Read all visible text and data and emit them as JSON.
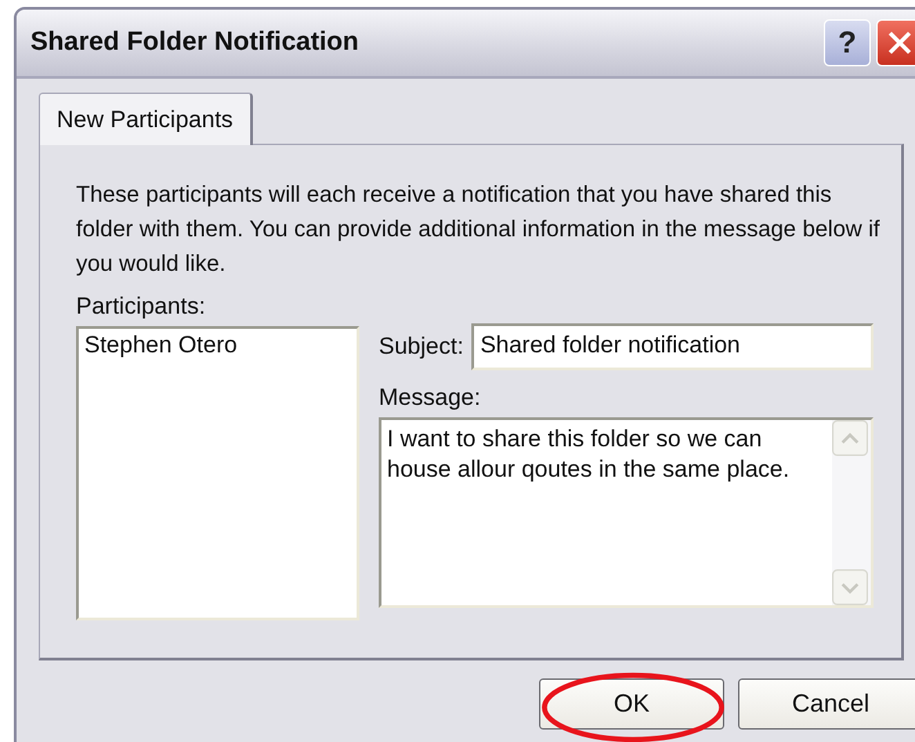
{
  "window": {
    "title": "Shared Folder Notification",
    "title_buttons": [
      {
        "kind": "help",
        "label": "?"
      },
      {
        "kind": "close"
      }
    ]
  },
  "tabs": [
    {
      "label": "New Participants",
      "selected": true
    }
  ],
  "description": "These participants will each receive a notification that you have shared this folder with them.  You can provide additional information in the message below if you would like.",
  "participants": {
    "label": "Participants:",
    "items": [
      "Stephen Otero"
    ]
  },
  "subject": {
    "label": "Subject:",
    "value": "Shared folder notification"
  },
  "message": {
    "label": "Message:",
    "value": "I want to share this folder so we can house allour qoutes in the same place."
  },
  "buttons": [
    {
      "label": "OK",
      "circled": true
    },
    {
      "label": "Cancel",
      "circled": false
    }
  ]
}
